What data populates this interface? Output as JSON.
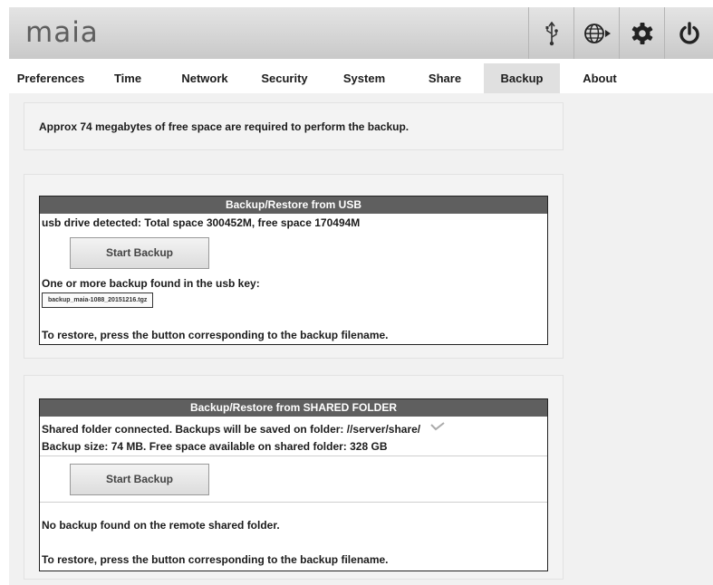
{
  "header": {
    "logo": "maia",
    "icons": [
      "usb-icon",
      "globe-icon",
      "gear-icon",
      "power-icon"
    ]
  },
  "tabs": [
    "Preferences",
    "Time",
    "Network",
    "Security",
    "System",
    "Share",
    "Backup",
    "About"
  ],
  "active_tab": "Backup",
  "info": {
    "text": "Approx 74 megabytes of free space are required to perform the backup."
  },
  "usb": {
    "title": "Backup/Restore from USB",
    "detected": "usb drive detected: Total space 300452M, free space 170494M",
    "start_button": "Start Backup",
    "found_label": "One or more backup found in the usb key:",
    "file": "backup_maia-1088_20151216.tgz",
    "restore_hint": "To restore, press the button corresponding to the backup filename."
  },
  "shared": {
    "title": "Backup/Restore from SHARED FOLDER",
    "connected": "Shared folder connected. Backups will be saved on folder: //server/share/",
    "size_info": "Backup size: 74 MB. Free space available on shared folder: 328 GB",
    "start_button": "Start Backup",
    "none_found": "No backup found on the remote shared folder.",
    "restore_hint": "To restore, press the button corresponding to the backup filename."
  }
}
